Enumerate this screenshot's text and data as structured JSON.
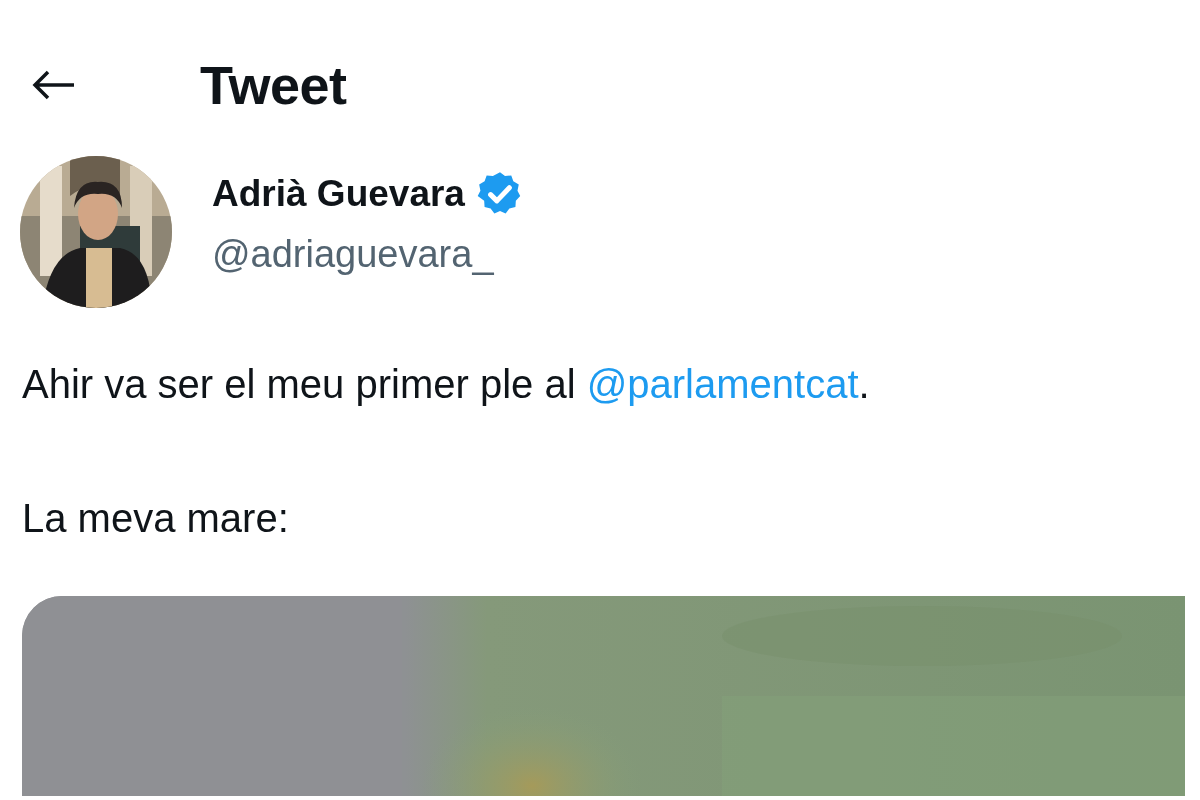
{
  "header": {
    "title": "Tweet"
  },
  "author": {
    "name": "Adrià Guevara",
    "verified": true,
    "handle": "@adriaguevara_"
  },
  "tweet": {
    "paragraphs": [
      {
        "parts": [
          {
            "kind": "text",
            "text": "Ahir va ser el meu primer ple al "
          },
          {
            "kind": "mention",
            "text": "@parlamentcat"
          },
          {
            "kind": "text",
            "text": "."
          }
        ]
      },
      {
        "parts": [
          {
            "kind": "text",
            "text": "La meva mare:"
          }
        ]
      }
    ]
  }
}
